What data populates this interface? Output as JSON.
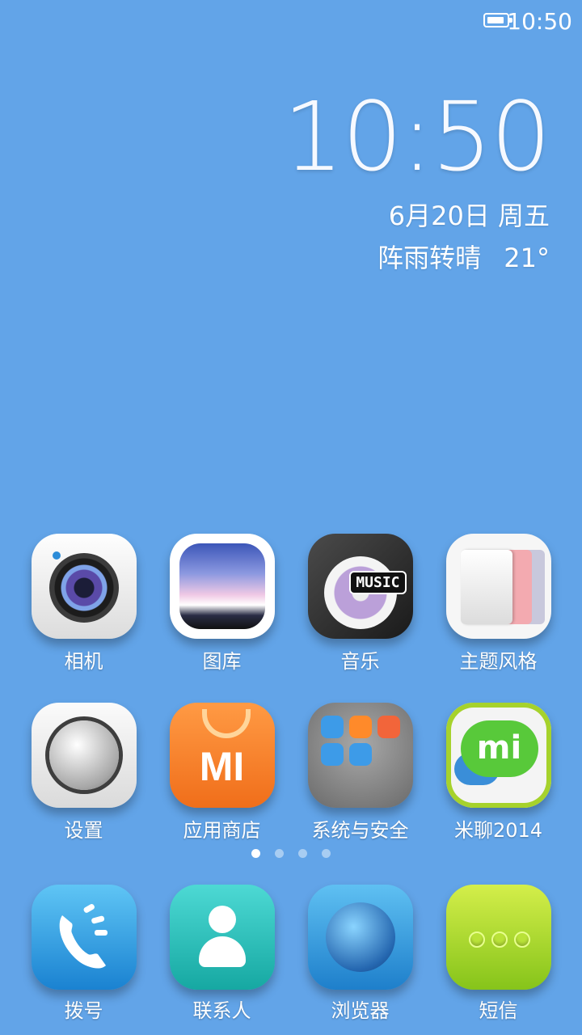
{
  "status_bar": {
    "time": "10:50",
    "battery_level": 0.9
  },
  "clock_widget": {
    "time": "10:50",
    "date": "6月20日 周五",
    "weather": "阵雨转晴",
    "temperature": "21°"
  },
  "apps": [
    {
      "label": "相机"
    },
    {
      "label": "图库"
    },
    {
      "label": "音乐",
      "badge_text": "MUSIC"
    },
    {
      "label": "主题风格"
    },
    {
      "label": "设置"
    },
    {
      "label": "应用商店",
      "badge_text": "MI"
    },
    {
      "label": "系统与安全"
    },
    {
      "label": "米聊2014",
      "badge_text": "mi"
    }
  ],
  "page_indicator": {
    "pages": 4,
    "current": 1
  },
  "dock": [
    {
      "label": "拨号"
    },
    {
      "label": "联系人"
    },
    {
      "label": "浏览器"
    },
    {
      "label": "短信"
    }
  ],
  "colors": {
    "wallpaper": "#62a4e8",
    "text": "#ffffff"
  }
}
